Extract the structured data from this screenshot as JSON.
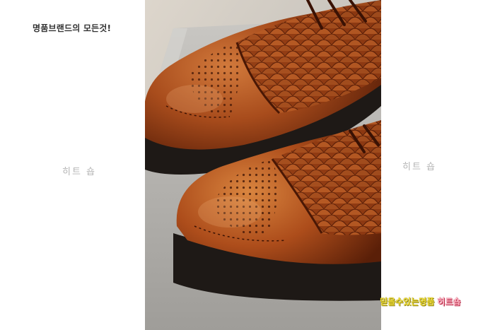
{
  "tagline": "명품브랜드의 모든것!",
  "watermark": {
    "left": "히트 숍",
    "right": "히트 숍"
  },
  "promo": {
    "part1": "믿을수있는명품",
    "part2": "히트숍"
  },
  "photo": {
    "subject": "brown-leather-brogue-shoes-on-grey-box-icon"
  },
  "colors": {
    "leather": "#a5461a",
    "leather_dark": "#5a1f08",
    "sole": "#1f1a17",
    "box": "#b9b8b4",
    "promo_yellow": "#f4e23a",
    "promo_pink": "#ffb9c8"
  }
}
